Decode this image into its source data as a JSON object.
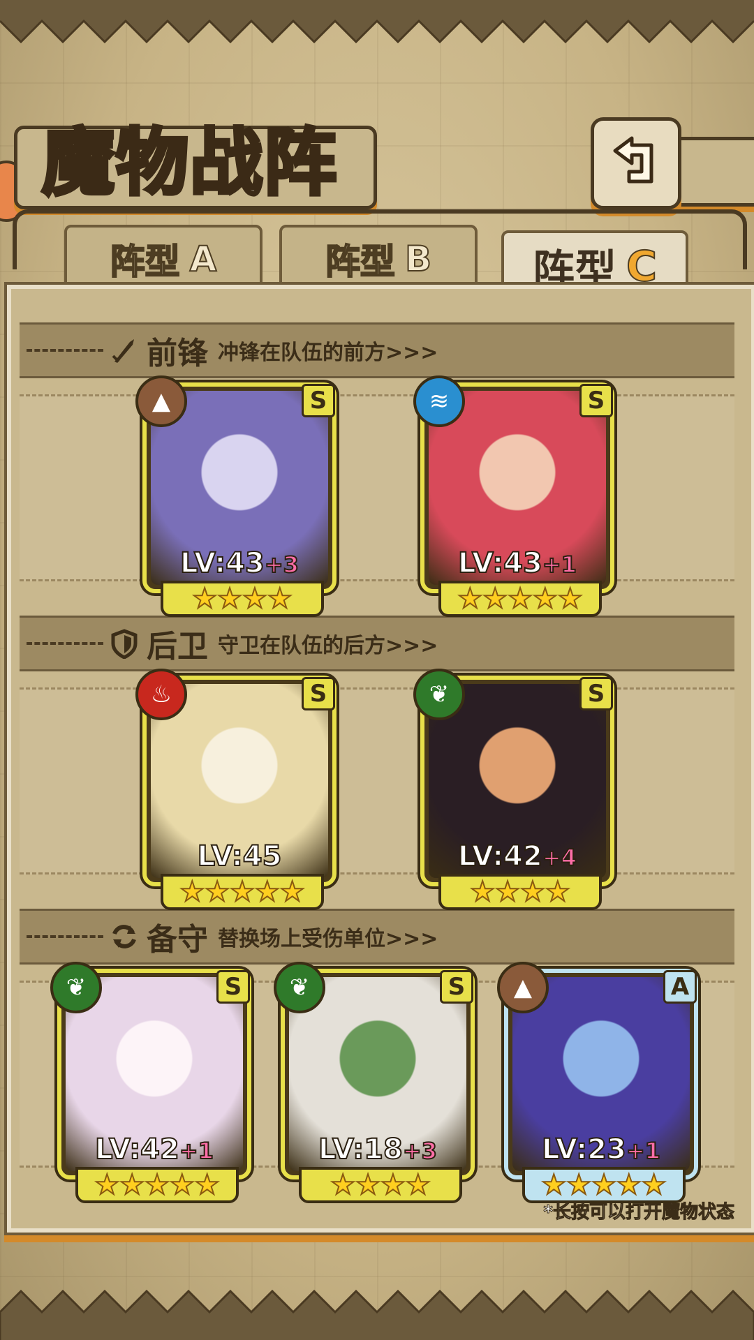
{
  "title": "魔物战阵",
  "tabs": [
    {
      "prefix": "阵型",
      "letter": "A",
      "active": false
    },
    {
      "prefix": "阵型",
      "letter": "B",
      "active": false
    },
    {
      "prefix": "阵型",
      "letter": "C",
      "active": true
    }
  ],
  "sections": [
    {
      "icon": "sword-icon",
      "title": "前锋",
      "subtitle": "冲锋在队伍的前方>>>"
    },
    {
      "icon": "shield-icon",
      "title": "后卫",
      "subtitle": "守卫在队伍的后方>>>"
    },
    {
      "icon": "swap-icon",
      "title": "备守",
      "subtitle": "替换场上受伤单位>>>"
    }
  ],
  "monsters": [
    {
      "rank": "S",
      "element": "earth-element-icon",
      "element_color": "#8a5a3a",
      "level": "LV:43",
      "plus": "+3",
      "stars": "★★★★",
      "palette": [
        "#7a6fb8",
        "#d9d4f0"
      ]
    },
    {
      "rank": "S",
      "element": "water-element-icon",
      "element_color": "#2a8fd0",
      "level": "LV:43",
      "plus": "+1",
      "stars": "★★★★★",
      "palette": [
        "#d84a5a",
        "#f2c7b0"
      ]
    },
    {
      "rank": "S",
      "element": "fire-element-icon",
      "element_color": "#c8281e",
      "level": "LV:45",
      "plus": "",
      "stars": "★★★★★",
      "palette": [
        "#e8d9a8",
        "#f7f0dd"
      ]
    },
    {
      "rank": "S",
      "element": "wood-element-icon",
      "element_color": "#2f7a2a",
      "level": "LV:42",
      "plus": "+4",
      "stars": "★★★★",
      "palette": [
        "#2a1e24",
        "#e0a070"
      ]
    },
    {
      "rank": "S",
      "element": "wood-element-icon",
      "element_color": "#2f7a2a",
      "level": "LV:42",
      "plus": "+1",
      "stars": "★★★★★",
      "palette": [
        "#e8d6e8",
        "#fdf4f8"
      ]
    },
    {
      "rank": "S",
      "element": "wood-element-icon",
      "element_color": "#2f7a2a",
      "level": "LV:18",
      "plus": "+3",
      "stars": "★★★★",
      "palette": [
        "#e4e0d8",
        "#6a9a5a"
      ]
    },
    {
      "rank": "A",
      "element": "earth-element-icon",
      "element_color": "#8a5a3a",
      "level": "LV:23",
      "plus": "+1",
      "stars": "★★★★★",
      "palette": [
        "#4a3ea0",
        "#8fb4e8"
      ]
    }
  ],
  "hint": "*长按可以打开魔物状态"
}
